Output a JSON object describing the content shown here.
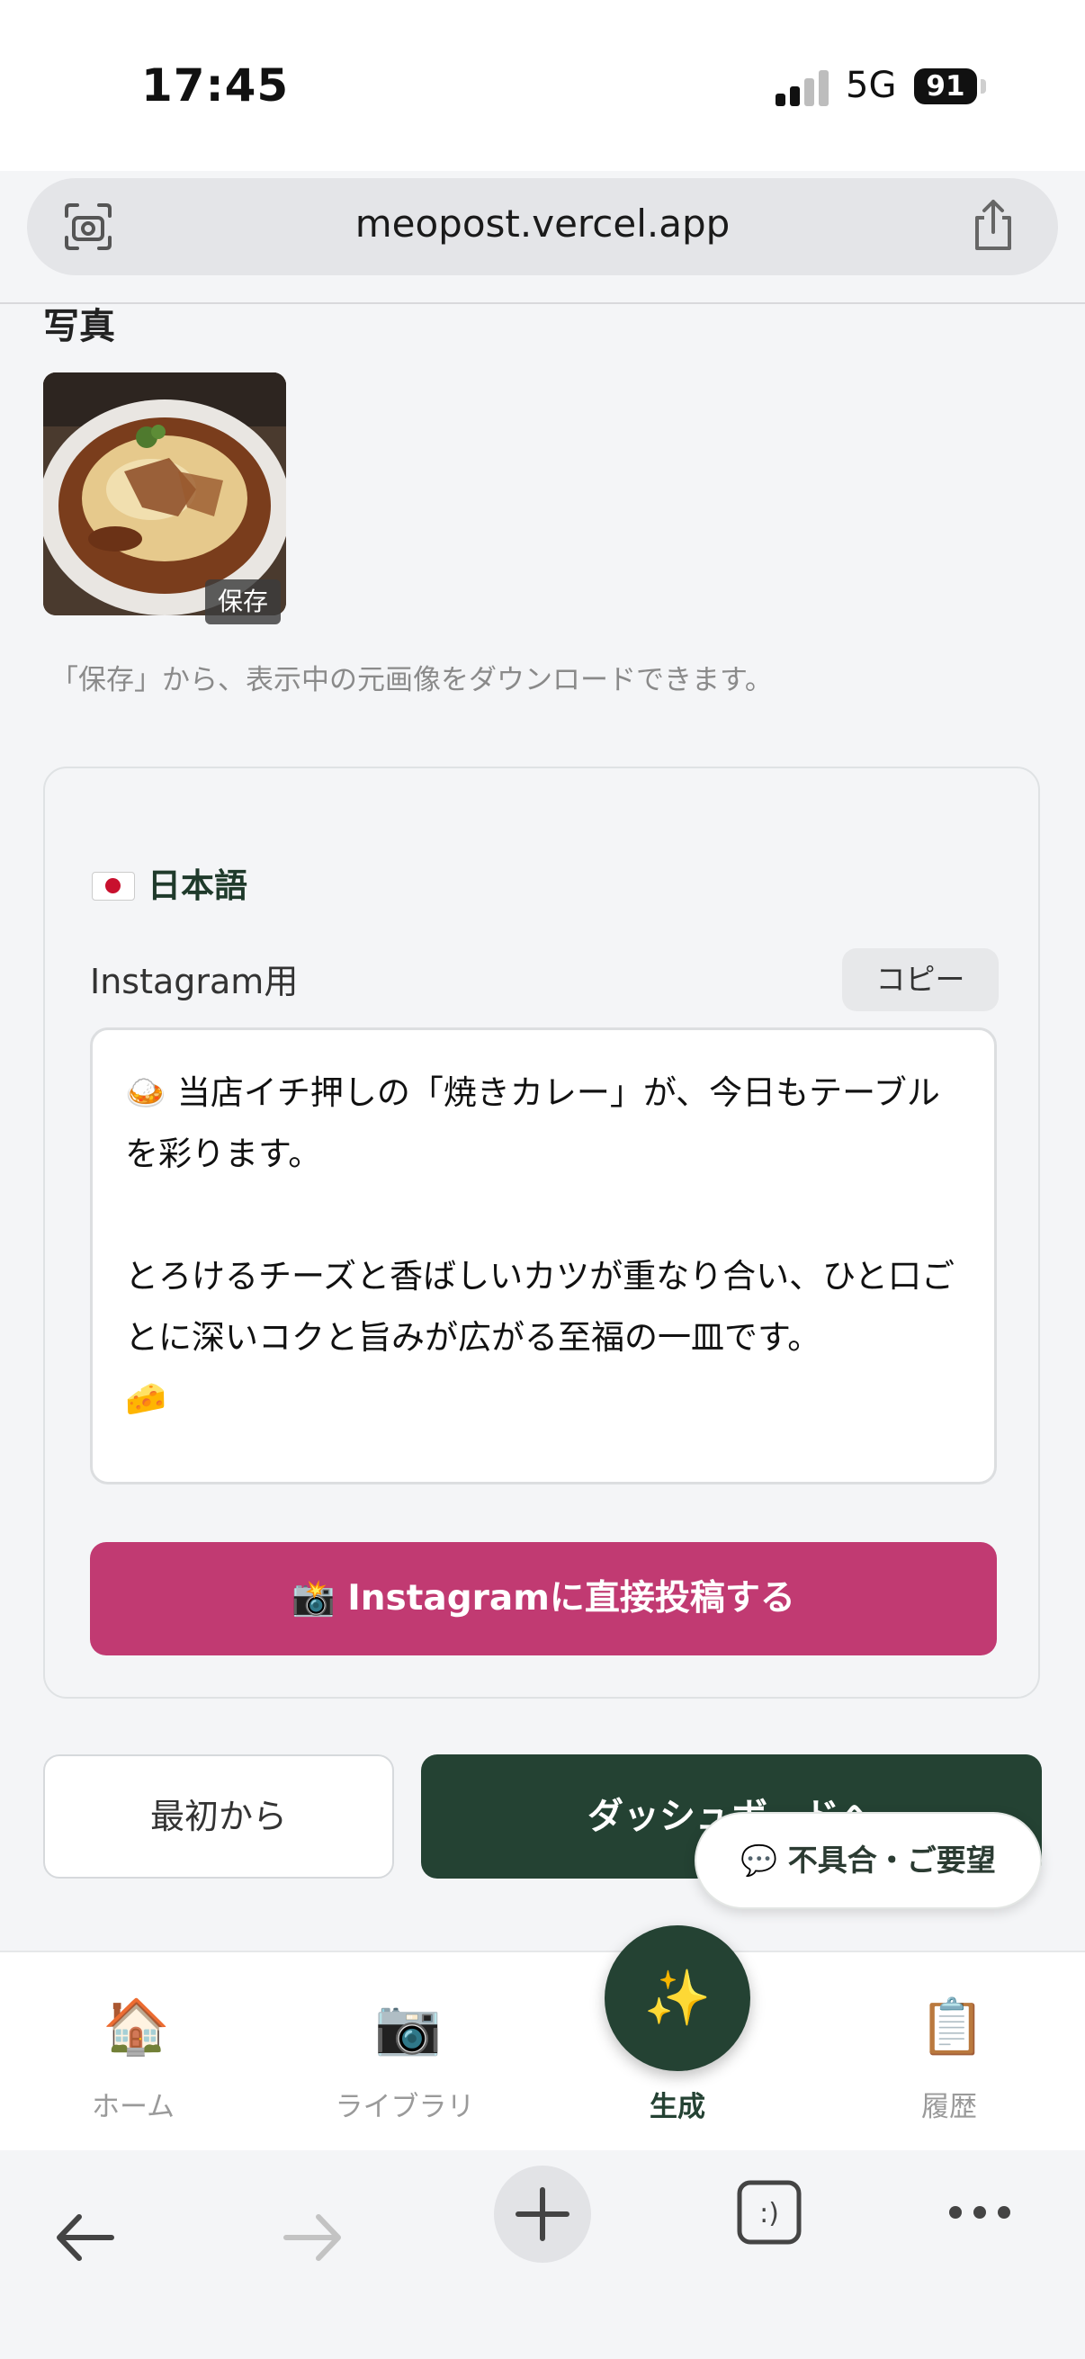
{
  "status_bar": {
    "time": "17:45",
    "network": "5G",
    "battery": "91"
  },
  "browser": {
    "url": "meopost.vercel.app"
  },
  "photo_section": {
    "title": "写真",
    "save_label": "保存",
    "hint": "「保存」から、表示中の元画像をダウンロードできます。"
  },
  "caption_card": {
    "language": "日本語",
    "instagram_label": "Instagram用",
    "copy_label": "コピー",
    "caption_line1": "🍛 当店イチ押しの「焼きカレー」が、今日もテーブルを彩ります。",
    "caption_line2": "とろけるチーズと香ばしいカツが重なり合い、ひと口ごとに深いコクと旨みが広がる至福の一皿です。",
    "caption_line3": "🧀",
    "post_button": "Instagramに直接投稿する"
  },
  "actions": {
    "restart": "最初から",
    "dashboard": "ダッシュボードへ"
  },
  "feedback": {
    "label": "不具合・ご要望"
  },
  "tabbar": {
    "items": [
      {
        "label": "ホーム",
        "icon": "house-icon"
      },
      {
        "label": "ライブラリ",
        "icon": "camera-icon"
      },
      {
        "label": "生成",
        "icon": "sparkles-icon"
      },
      {
        "label": "履歴",
        "icon": "clipboard-icon"
      }
    ],
    "active": "生成"
  },
  "colors": {
    "brand_green": "#244233",
    "instagram_pink": "#c13a72"
  }
}
